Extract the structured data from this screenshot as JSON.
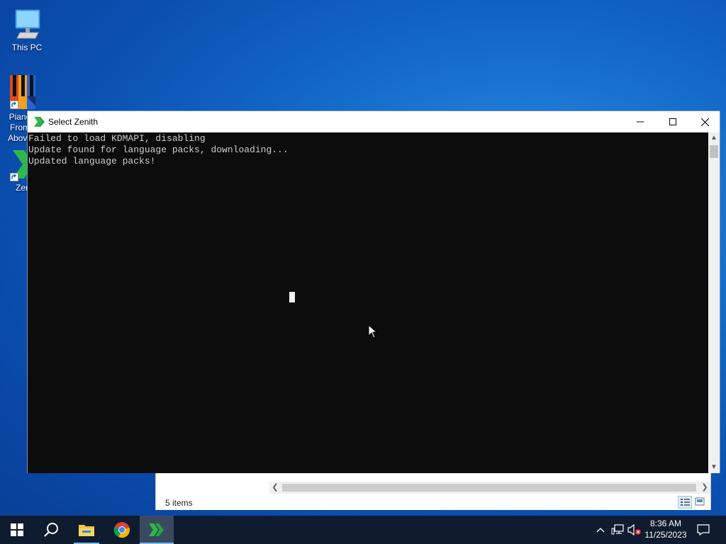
{
  "desktop": {
    "icons": [
      {
        "label": "This PC"
      },
      {
        "label": "Piano From Above"
      },
      {
        "label": "Zenith"
      }
    ]
  },
  "console_window": {
    "title": "Select Zenith",
    "lines": [
      "Failed to load KDMAPI, disabling",
      "Update found for language packs, downloading...",
      "Updated language packs!"
    ]
  },
  "explorer_window": {
    "status_items": "5 items"
  },
  "taskbar": {
    "apps": [
      {
        "name": "start-icon"
      },
      {
        "name": "search-icon"
      },
      {
        "name": "file-explorer-icon"
      },
      {
        "name": "chrome-icon"
      },
      {
        "name": "zenith-icon"
      }
    ],
    "time": "8:36 AM",
    "date": "11/25/2023"
  },
  "colors": {
    "console_bg": "#0c0c0c",
    "console_text": "#cccccc",
    "taskbar_bg": "#0f1b2e",
    "accent": "#76b9ed",
    "zenith_green": "#2db84a"
  }
}
